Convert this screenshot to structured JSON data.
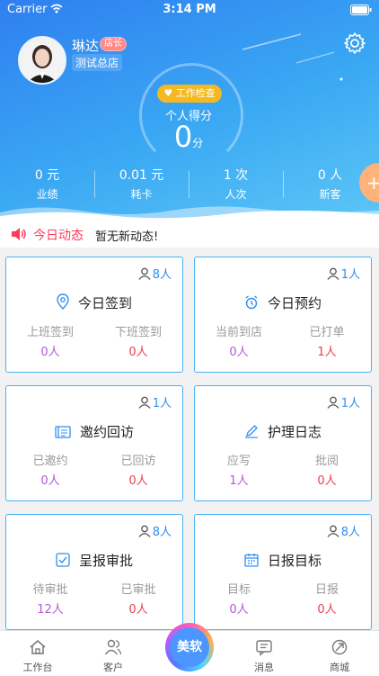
{
  "status": {
    "carrier": "Carrier",
    "time": "3:14 PM"
  },
  "user": {
    "name": "琳达",
    "role": "店长",
    "store": "测试总店"
  },
  "score": {
    "button": "工作检查",
    "label": "个人得分",
    "value": "0",
    "unit": "分"
  },
  "stats": [
    {
      "value": "0 元",
      "label": "业绩"
    },
    {
      "value": "0.01 元",
      "label": "耗卡"
    },
    {
      "value": "1 次",
      "label": "人次"
    },
    {
      "value": "0 人",
      "label": "新客"
    }
  ],
  "news": {
    "title": "今日动态",
    "text": "暂无新动态!"
  },
  "cards": [
    {
      "title": "今日签到",
      "count": "8人",
      "left_label": "上班签到",
      "left_value": "0人",
      "right_label": "下班签到",
      "right_value": "0人"
    },
    {
      "title": "今日预约",
      "count": "1人",
      "left_label": "当前到店",
      "left_value": "0人",
      "right_label": "已打单",
      "right_value": "1人"
    },
    {
      "title": "邀约回访",
      "count": "1人",
      "left_label": "已邀约",
      "left_value": "0人",
      "right_label": "已回访",
      "right_value": "0人"
    },
    {
      "title": "护理日志",
      "count": "1人",
      "left_label": "应写",
      "left_value": "1人",
      "right_label": "批阅",
      "right_value": "0人"
    },
    {
      "title": "呈报审批",
      "count": "8人",
      "left_label": "待审批",
      "left_value": "12人",
      "right_label": "已审批",
      "right_value": "0人"
    },
    {
      "title": "日报目标",
      "count": "8人",
      "left_label": "目标",
      "left_value": "0人",
      "right_label": "日报",
      "right_value": "0人"
    }
  ],
  "tabs": [
    "工作台",
    "客户",
    "美软",
    "消息",
    "商城"
  ],
  "colors": {
    "accent": "#2f8ef0",
    "header_start": "#2f7ff0",
    "header_end": "#5cc6f6",
    "alert": "#ff3b5c",
    "purple_value": "#b35ad6",
    "red_value": "#f03d4b"
  }
}
